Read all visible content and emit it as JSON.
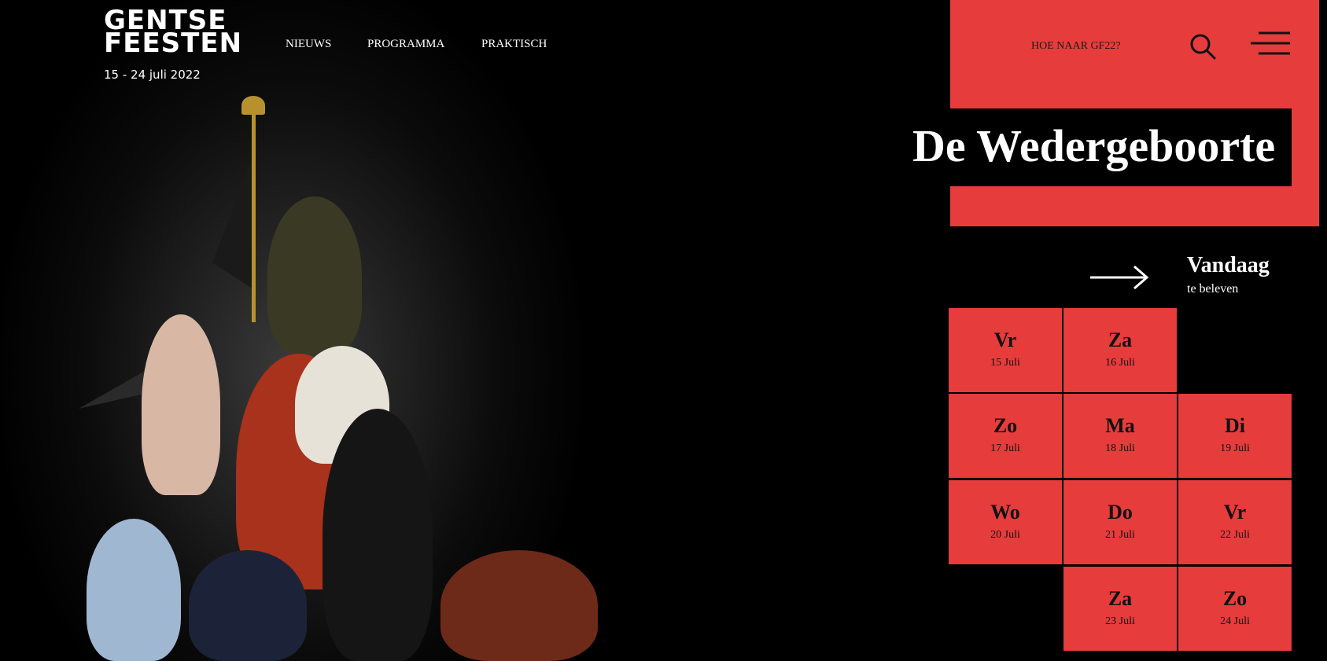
{
  "header": {
    "logo_line1": "GENTSE",
    "logo_line2": "FEESTEN",
    "dates": "15 - 24 juli 2022",
    "nav": [
      "NIEUWS",
      "PROGRAMMA",
      "PRAKTISCH"
    ],
    "how_to": "HOE NAAR GF22?",
    "icons": {
      "search": "search-icon",
      "menu": "hamburger-menu-icon"
    }
  },
  "hero": {
    "title": "De Wedergeboorte"
  },
  "today": {
    "title": "Vandaag",
    "subtitle": "te beleven",
    "icon": "arrow-right-icon"
  },
  "calendar": [
    {
      "day": "Vr",
      "date": "15 Juli"
    },
    {
      "day": "Za",
      "date": "16 Juli"
    },
    {
      "day": "Zo",
      "date": "17 Juli"
    },
    {
      "day": "Ma",
      "date": "18 Juli"
    },
    {
      "day": "Di",
      "date": "19 Juli"
    },
    {
      "day": "Wo",
      "date": "20 Juli"
    },
    {
      "day": "Do",
      "date": "21 Juli"
    },
    {
      "day": "Vr",
      "date": "22 Juli"
    },
    {
      "day": "Za",
      "date": "23 Juli"
    },
    {
      "day": "Zo",
      "date": "24 Juli"
    }
  ],
  "colors": {
    "accent": "#e63c3c",
    "background": "#000000"
  }
}
